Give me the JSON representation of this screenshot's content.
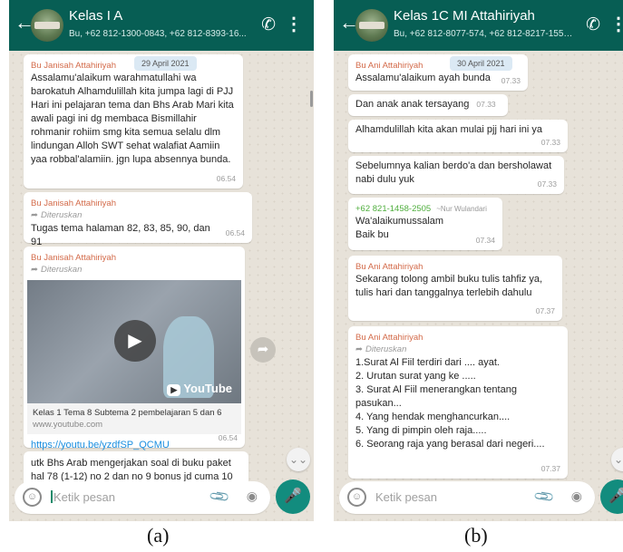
{
  "panel_a": {
    "header": {
      "title": "Kelas I A",
      "subtitle": "Bu, +62 812-1300-0843, +62 812-8393-16..."
    },
    "messages": {
      "m1": {
        "sender": "Bu Janisah Attahiriyah",
        "date_chip": "29 April 2021",
        "text": "Assalamu'alaikum warahmatullahi wa barokatuh Alhamdulillah kita jumpa lagi di PJJ Hari ini pelajaran tema dan Bhs Arab Mari kita awali pagi ini dg membaca Bismillahir rohmanir rohiim smg kita semua selalu dlm lindungan Alloh SWT sehat walafiat Aamiin yaa robbal'alamiin. jgn lupa absennya bunda.",
        "time": "06.54"
      },
      "m2": {
        "sender": "Bu Janisah Attahiriyah",
        "forwarded": "Diteruskan",
        "text": "Tugas tema halaman 82, 83, 85, 90, dan 91",
        "time": "06.54"
      },
      "m3": {
        "sender": "Bu Janisah Attahiriyah",
        "forwarded": "Diteruskan",
        "yt_label": "YouTube",
        "preview_title": "Kelas 1 Tema 8 Subtema 2 pembelajaran 5 dan 6",
        "preview_domain": "www.youtube.com",
        "link": "https://youtu.be/yzdfSP_QCMU",
        "time": "06.54"
      },
      "m4": {
        "text": "utk Bhs Arab mengerjakan soal di buku paket hal 78 (1-12) no 2 dan  no 9 bonus jd cuma 10"
      }
    },
    "input": {
      "placeholder": "Ketik pesan"
    }
  },
  "panel_b": {
    "header": {
      "title": "Kelas 1C MI Attahiriyah",
      "subtitle": "Bu, +62 812-8077-574, +62 812-8217-1554..."
    },
    "messages": {
      "m1": {
        "sender": "Bu Ani Attahiriyah",
        "date_chip": "30 April 2021",
        "text": "Assalamu'alaikum ayah bunda",
        "time": "07.33"
      },
      "m2": {
        "text": "Dan anak anak tersayang",
        "time": "07.33"
      },
      "m3": {
        "text": "Alhamdulillah kita akan mulai pjj hari ini ya",
        "time": "07.33"
      },
      "m4": {
        "text": "Sebelumnya kalian berdo'a dan bersholawat nabi dulu yuk",
        "time": "07.33"
      },
      "m5": {
        "sender": "+62 821-1458-2505",
        "alt_name": "~Nur Wulandari",
        "text": "Wa'alaikumussalam\nBaik bu",
        "time": "07.34"
      },
      "m6": {
        "sender": "Bu Ani Attahiriyah",
        "text": "Sekarang tolong ambil buku tulis tahfiz ya, tulis hari dan tanggalnya terlebih dahulu",
        "time": "07.37"
      },
      "m7": {
        "sender": "Bu Ani Attahiriyah",
        "forwarded": "Diteruskan",
        "lines": [
          "1.Surat Al Fiil terdiri dari .... ayat.",
          "2. Urutan surat yang ke .....",
          "3. Surat Al Fiil menerangkan tentang pasukan...",
          "4. Yang hendak menghancurkan....",
          "5. Yang di pimpin oleh raja.....",
          "6. Seorang raja yang berasal dari negeri...."
        ],
        "time": "07.37"
      }
    },
    "input": {
      "placeholder": "Ketik pesan"
    }
  },
  "captions": {
    "a": "(a)",
    "b": "(b)"
  },
  "colors": {
    "header": "#075e54",
    "mic": "#128c7e",
    "sender": "#d36b4a",
    "sender_alt": "#4fae3d",
    "link": "#1b8fe0",
    "chat_bg": "#e7e2d9"
  },
  "icons": {
    "back": "back-arrow-icon",
    "call": "add-call-icon",
    "more": "more-vert-icon",
    "emoji": "emoji-icon",
    "attach": "paperclip-icon",
    "camera": "camera-icon",
    "mic": "mic-icon",
    "play": "play-icon",
    "forward": "forward-icon",
    "scroll_down": "double-chevron-down-icon"
  }
}
